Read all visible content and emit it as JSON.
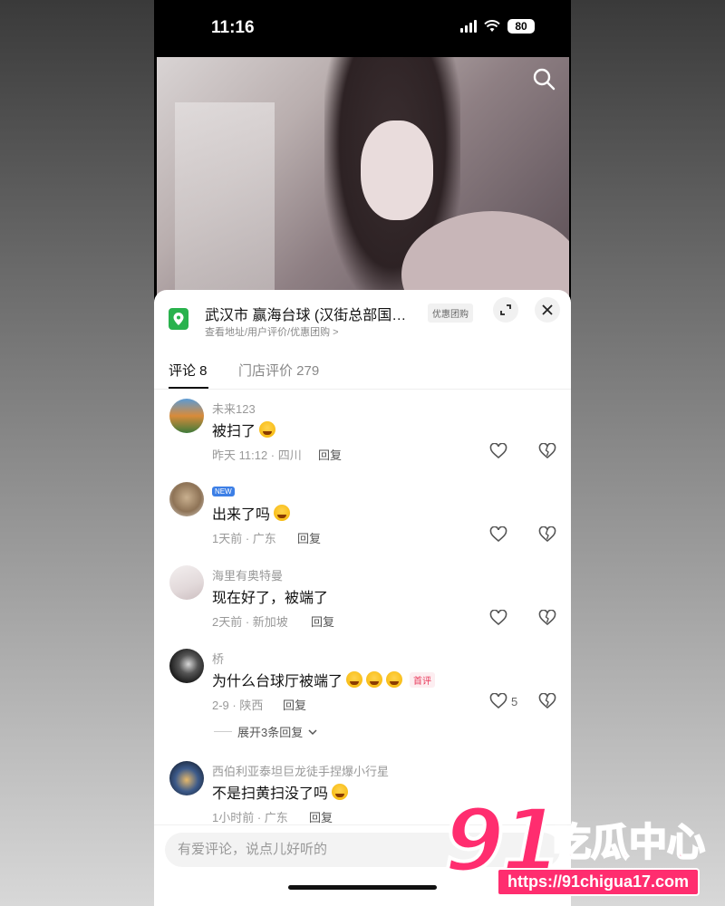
{
  "status": {
    "time": "11:16",
    "battery": "80"
  },
  "location": {
    "title": "武汉市 赢海台球 (汉街总部国…",
    "subtitle": "查看地址/用户评价/优惠团购 >",
    "deal_tag": "优惠团购"
  },
  "tabs": [
    {
      "label": "评论 8",
      "active": true
    },
    {
      "label": "门店评价 279",
      "active": false
    }
  ],
  "comments": [
    {
      "user": "未来123",
      "text": "被扫了",
      "emoji_count": 1,
      "meta": "昨天 11:12 · 四川",
      "reply": "回复",
      "likes": ""
    },
    {
      "user": "",
      "badge": "NEW",
      "text": "出来了吗",
      "emoji_count": 1,
      "meta": "1天前 · 广东",
      "reply": "回复",
      "likes": ""
    },
    {
      "user": "海里有奥特曼",
      "text": "现在好了，被端了",
      "emoji_count": 0,
      "meta": "2天前 · 新加坡",
      "reply": "回复",
      "likes": ""
    },
    {
      "user": "桥",
      "text": "为什么台球厅被端了",
      "emoji_count": 3,
      "tag": "首评",
      "meta": "2-9 · 陕西",
      "reply": "回复",
      "likes": "5"
    },
    {
      "user": "西伯利亚泰坦巨龙徒手捏爆小行星",
      "text": "不是扫黄扫没了吗",
      "emoji_count": 1,
      "meta": "1小时前 · 广东",
      "reply": "回复",
      "likes": ""
    }
  ],
  "expand_replies": "展开3条回复",
  "input": {
    "placeholder": "有爱评论，说点儿好听的"
  },
  "watermark": {
    "number": "91",
    "name": "吃瓜中心",
    "url": "https://91chigua17.com"
  },
  "colors": {
    "accent": "#ff2d6f",
    "location_green": "#29b24d",
    "text_primary": "#111111",
    "text_secondary": "#999999"
  }
}
